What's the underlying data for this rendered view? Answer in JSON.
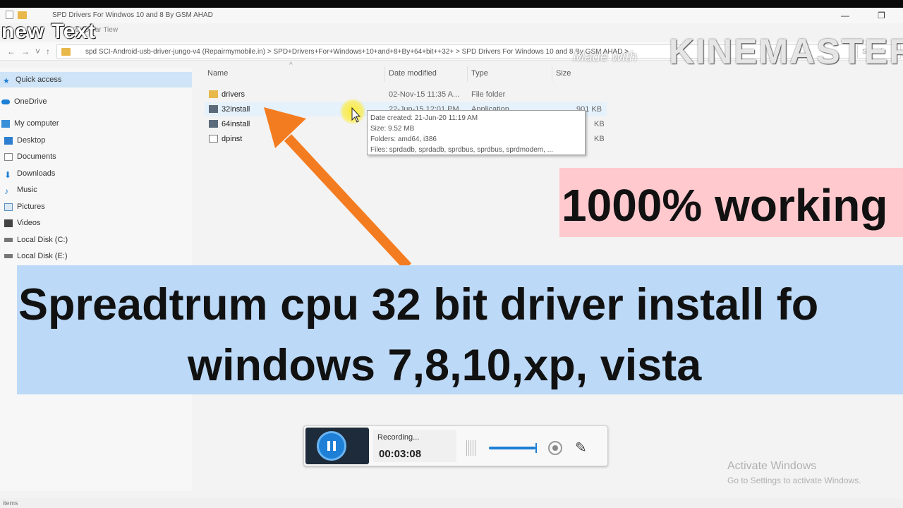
{
  "window": {
    "title": "SPD Drivers For Windwos 10 and 8 By GSM AHAD",
    "ribbon_text": "Komp   Var   Tiew"
  },
  "overlay_text": "new Text",
  "address": {
    "path": "spd SCI-Android-usb-driver-jungo-v4 (Repairmymobile.in)  >  SPD+Drivers+For+Windows+10+and+8+By+64+bit++32+  >  SPD Drivers For Windows 10 and 8 By GSM AHAD  >",
    "search_placeholder": "Search"
  },
  "watermark": {
    "made_with": "Made with",
    "brand": "KINEMASTER"
  },
  "nav": {
    "quick_access": "Quick access",
    "onedrive": "OneDrive",
    "my_computer": "My computer",
    "desktop": "Desktop",
    "documents": "Documents",
    "downloads": "Downloads",
    "music": "Music",
    "pictures": "Pictures",
    "videos": "Videos",
    "local_c": "Local Disk (C:)",
    "local_e": "Local Disk (E:)"
  },
  "columns": {
    "name": "Name",
    "date_modified": "Date modified",
    "type": "Type",
    "size": "Size"
  },
  "files": [
    {
      "name": "drivers",
      "date": "02-Nov-15 11:35 A...",
      "type": "File folder",
      "size": ""
    },
    {
      "name": "32install",
      "date": "22-Jun-15 12:01 PM",
      "type": "Application",
      "size": "901 KB"
    },
    {
      "name": "64install",
      "date": "",
      "type": "",
      "size": "KB"
    },
    {
      "name": "dpinst",
      "date": "",
      "type": "",
      "size": "KB"
    }
  ],
  "tooltip": {
    "line1": "Date created: 21-Jun-20 11:19 AM",
    "line2": "Size: 9.52 MB",
    "line3": "Folders: amd64, i386",
    "line4": "Files: sprdadb, sprdadb, sprdbus, sprdbus, sprdmodem, ..."
  },
  "badge": "1000% working",
  "banner": {
    "line1": "Spreadtrum cpu 32 bit driver install fo",
    "line2": "windows 7,8,10,xp, vista"
  },
  "recorder": {
    "status": "Recording...",
    "time": "00:03:08"
  },
  "activation": {
    "title": "Activate Windows",
    "subtitle": "Go to Settings to activate Windows."
  },
  "statusbar": "items",
  "colors": {
    "arrow": "#f47c20",
    "badge_bg": "#ffc9ce",
    "banner_bg": "#bcd9f7",
    "folder": "#e8b84a",
    "selection": "#cfe4f7"
  }
}
